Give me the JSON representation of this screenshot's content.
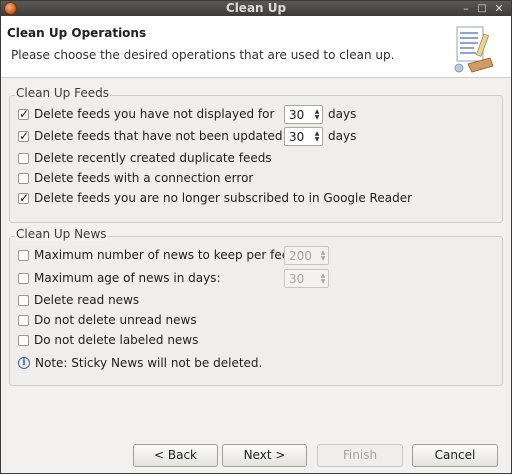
{
  "window": {
    "title": "Clean Up"
  },
  "header": {
    "title": "Clean Up Operations",
    "description": "Please choose the desired operations that are used to clean up."
  },
  "feeds_group": {
    "label": "Clean Up Feeds",
    "items": [
      {
        "label": "Delete feeds you have not displayed for",
        "checked": true,
        "value": "30",
        "unit": "days"
      },
      {
        "label": "Delete feeds that have not been updated for",
        "checked": true,
        "value": "30",
        "unit": "days"
      },
      {
        "label": "Delete recently created duplicate feeds",
        "checked": false
      },
      {
        "label": "Delete feeds with a connection error",
        "checked": false
      },
      {
        "label": "Delete feeds you are no longer subscribed to in Google Reader",
        "checked": true
      }
    ]
  },
  "news_group": {
    "label": "Clean Up News",
    "items": [
      {
        "label": "Maximum number of news to keep per feed:",
        "checked": false,
        "value": "200"
      },
      {
        "label": "Maximum age of news in days:",
        "checked": false,
        "value": "30"
      },
      {
        "label": "Delete read news",
        "checked": false
      },
      {
        "label": "Do not delete unread news",
        "checked": false
      },
      {
        "label": "Do not delete labeled news",
        "checked": false
      }
    ],
    "note": "Note: Sticky News will not be deleted."
  },
  "buttons": {
    "back": "< Back",
    "next": "Next >",
    "finish": "Finish",
    "cancel": "Cancel"
  },
  "window_controls": {
    "minimize": "–",
    "maximize": "□",
    "close": "✕"
  }
}
